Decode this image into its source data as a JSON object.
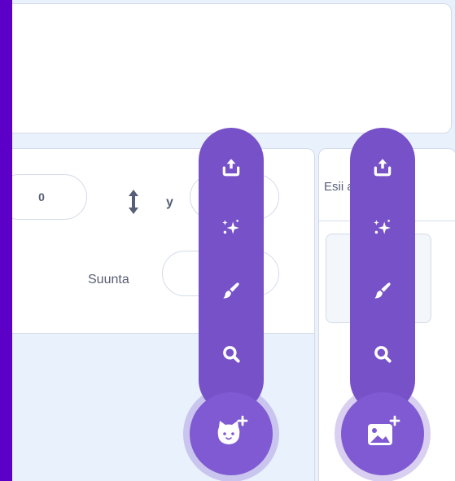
{
  "sprite_info": {
    "x_value": "0",
    "y_label": "y",
    "direction_label": "Suunta"
  },
  "backdrop_panel": {
    "title": "Esii      ava"
  },
  "sprite_menu": {
    "items": [
      {
        "icon": "upload-icon"
      },
      {
        "icon": "surprise-icon"
      },
      {
        "icon": "paint-icon"
      },
      {
        "icon": "search-icon"
      }
    ],
    "main_icon": "cat-add-icon"
  },
  "backdrop_menu": {
    "items": [
      {
        "icon": "upload-icon"
      },
      {
        "icon": "surprise-icon"
      },
      {
        "icon": "paint-icon"
      },
      {
        "icon": "search-icon"
      }
    ],
    "main_icon": "image-add-icon"
  },
  "colors": {
    "frame": "#5c00c7",
    "menu_purple": "#7751c8",
    "main_button": "#7f5ad2",
    "panel_bg": "#e9f1fc",
    "text": "#575e75"
  }
}
